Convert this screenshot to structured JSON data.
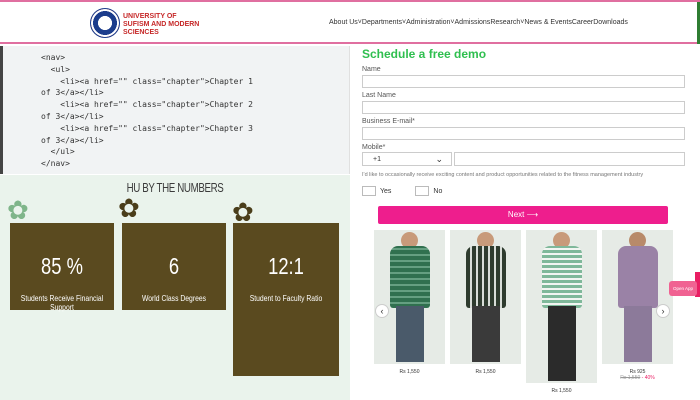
{
  "header": {
    "logo_text": "UNIVERSITY OF SUFISM AND MODERN SCIENCES",
    "nav": [
      "About Us",
      " ˅",
      "Departments",
      " ˅",
      "Administration",
      " ˅",
      "Admissions",
      "Research",
      " ˅",
      "News & Events",
      "Career",
      "Downloads"
    ]
  },
  "code": {
    "lines": [
      "<nav>",
      "  <ul>",
      "    <li><a href=\"\" class=\"chapter\">Chapter 1",
      "of 3</a></li>",
      "    <li><a href=\"\" class=\"chapter\">Chapter 2",
      "of 3</a></li>",
      "    <li><a href=\"\" class=\"chapter\">Chapter 3",
      "of 3</a></li>",
      "  </ul>",
      "</nav>"
    ]
  },
  "numbers": {
    "title": "HU BY THE NUMBERS",
    "cards": [
      {
        "value": "85 %",
        "label": "Students Receive Financial Support"
      },
      {
        "value": "6",
        "label": "World Class Degrees"
      },
      {
        "value": "12:1",
        "label": "Student to Faculty Ratio"
      }
    ]
  },
  "form": {
    "title": "Schedule a free demo",
    "name_label": "Name",
    "last_name_label": "Last Name",
    "email_label": "Business E-mail*",
    "mobile_label": "Mobile*",
    "country_code": "+1",
    "consent": "I'd like to occasionally receive exciting content and product opportunities related to the fitness management industry",
    "yes_label": "Yes",
    "no_label": "No",
    "next_label": "Next ⟶"
  },
  "products": [
    {
      "price": "Rs 1,550",
      "shirt_color": "#6fa98e",
      "pattern": "check-green"
    },
    {
      "price": "Rs 1,550",
      "shirt_color": "#2e3b2e",
      "pattern": "check-dark"
    },
    {
      "price": "Rs 1,550",
      "shirt_color": "#7fb89a",
      "pattern": "check-mint"
    },
    {
      "price": "Rs 925",
      "old_price": "Rs 1,550",
      "off": "- 40%",
      "shirt_color": "#9a82a6",
      "pattern": "solid-mauve"
    }
  ],
  "open_app_label": "Open App",
  "colors": {
    "accent_pink": "#ee1e8d",
    "form_title_green": "#2fbf4f",
    "card_brown": "#5a4a1f",
    "numbers_bg": "#eaf3ec"
  }
}
